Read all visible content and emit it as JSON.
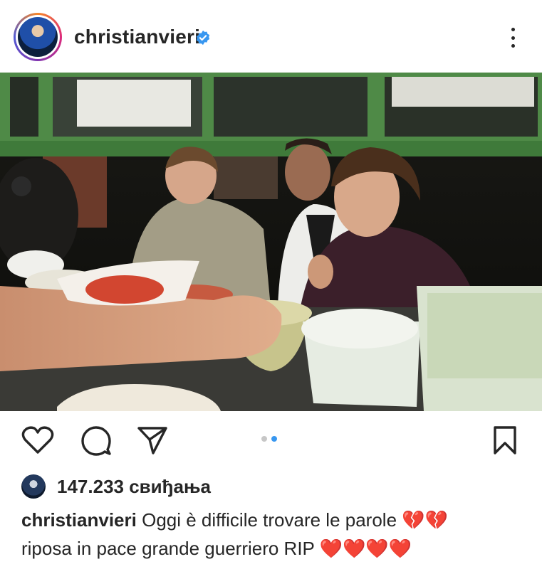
{
  "post": {
    "username": "christianvieri",
    "verified": true,
    "likes_text": "147.233 свиђања",
    "caption": {
      "username": "christianvieri",
      "line1": "Oggi è difficile trovare le parole",
      "line1_emoji": "💔💔",
      "line2": "riposa in pace grande guerriero RIP",
      "line2_emoji": "❤️❤️❤️❤️"
    }
  },
  "carousel": {
    "current": 2,
    "total": 2
  },
  "icons": {
    "verified": "verified-badge-icon",
    "more": "more-options-icon",
    "like": "heart-icon",
    "comment": "comment-icon",
    "share": "share-icon",
    "save": "bookmark-icon"
  },
  "colors": {
    "verified": "#3897f0",
    "text": "#262626",
    "dot_active": "#3897f0"
  }
}
